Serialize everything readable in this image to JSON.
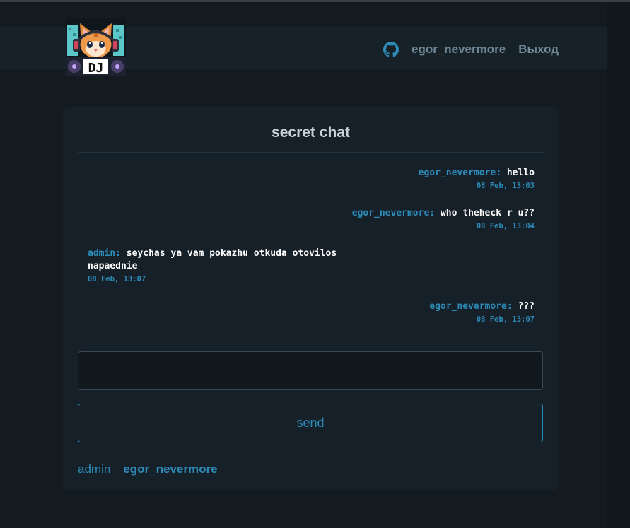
{
  "nav": {
    "logo_text": "DJ",
    "github_icon": "github-icon",
    "username": "egor_nevermore",
    "logout": "Выход"
  },
  "chat": {
    "title": "secret chat",
    "messages": [
      {
        "sender": "egor_nevermore:",
        "text": "hello",
        "time": "08 Feb, 13:03",
        "align": "right"
      },
      {
        "sender": "egor_nevermore:",
        "text": "who theheck r u??",
        "time": "08 Feb, 13:04",
        "align": "right"
      },
      {
        "sender": "admin:",
        "text": "seychas ya vam pokazhu otkuda otovilos napaednie",
        "time": "08 Feb, 13:07",
        "align": "left"
      },
      {
        "sender": "egor_nevermore:",
        "text": "???",
        "time": "08 Feb, 13:07",
        "align": "right"
      }
    ],
    "input_value": "",
    "send_label": "send"
  },
  "users": [
    "admin",
    "egor_nevermore"
  ],
  "colors": {
    "background": "#131a20",
    "card": "#162029",
    "accent": "#2d8bb8",
    "nav_text": "#6f8796"
  }
}
